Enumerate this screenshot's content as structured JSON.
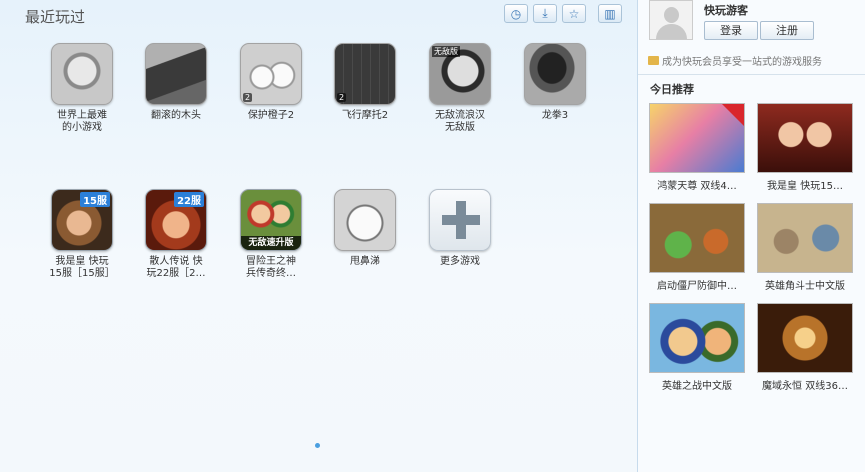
{
  "left": {
    "title": "最近玩过",
    "tools": [
      {
        "icon": "clock-icon",
        "glyph": "◷"
      },
      {
        "icon": "download-icon",
        "glyph": "⤓"
      },
      {
        "icon": "star-icon",
        "glyph": "☆"
      },
      {
        "icon": "trash-icon",
        "glyph": "▥"
      }
    ],
    "games": [
      {
        "name": "世界上最难\n的小游戏",
        "num": ""
      },
      {
        "name": "翻滚的木头",
        "num": ""
      },
      {
        "name": "保护橙子2",
        "num": "2"
      },
      {
        "name": "飞行摩托2",
        "num": "2"
      },
      {
        "name": "无敌流浪汉\n无敌版",
        "tag": "无敌版"
      },
      {
        "name": "龙拳3"
      },
      {
        "name": "我是皇 快玩\n15服［15服］",
        "badge": "15服"
      },
      {
        "name": "散人传说 快\n玩22服［2…",
        "badge": "22服"
      },
      {
        "name": "冒险王之神\n兵传奇终…",
        "band": "无敌速升版"
      },
      {
        "name": "甩鼻涕"
      },
      {
        "name": "更多游戏"
      }
    ]
  },
  "right": {
    "username": "快玩游客",
    "login_label": "登录",
    "register_label": "注册",
    "promo": "成为快玩会员享受一站式的游戏服务",
    "rec_title": "今日推荐",
    "recs": [
      {
        "name": "鸿蒙天尊 双线4…"
      },
      {
        "name": "我是皇 快玩15…"
      },
      {
        "name": "启动僵尸防御中…"
      },
      {
        "name": "英雄角斗士中文版"
      },
      {
        "name": "英雄之战中文版"
      },
      {
        "name": "魔域永恒 双线36…"
      }
    ]
  }
}
